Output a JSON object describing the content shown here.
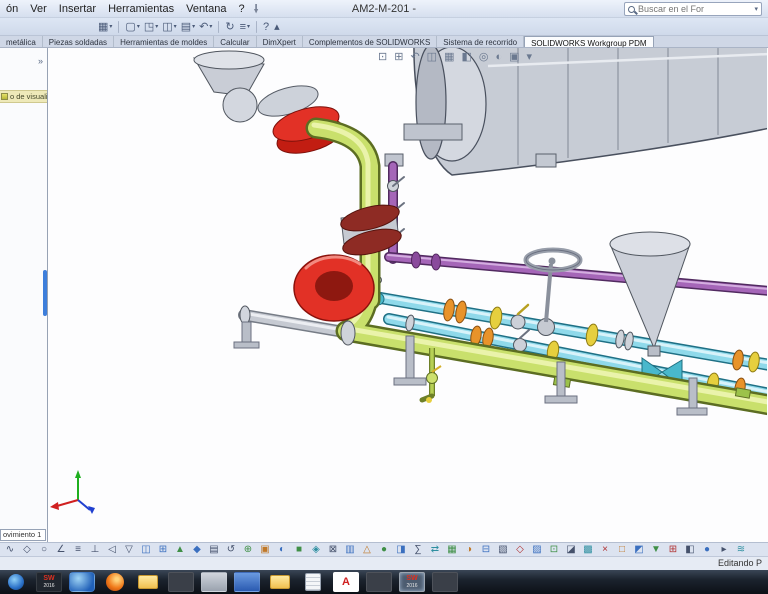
{
  "titlebar": {
    "document": "AM2-M-201 -"
  },
  "menubar": {
    "menus": [
      {
        "name": "menu-edicion",
        "label": "ón"
      },
      {
        "name": "menu-ver",
        "label": "Ver"
      },
      {
        "name": "menu-insertar",
        "label": "Insertar"
      },
      {
        "name": "menu-herramientas",
        "label": "Herramientas"
      },
      {
        "name": "menu-ventana",
        "label": "Ventana"
      },
      {
        "name": "menu-ayuda",
        "label": "?"
      }
    ]
  },
  "search": {
    "placeholder": "Buscar en el For",
    "caret": "▾"
  },
  "quickbar": {
    "icons": [
      {
        "name": "sketch-icon",
        "glyph": "▦",
        "caret": "▾"
      },
      {
        "name": "separator",
        "cls": "sep"
      },
      {
        "name": "new-document-icon",
        "glyph": "▢",
        "caret": "▾"
      },
      {
        "name": "open-icon",
        "glyph": "◳",
        "caret": "▾"
      },
      {
        "name": "save-icon",
        "glyph": "◫",
        "caret": "▾"
      },
      {
        "name": "print-icon",
        "glyph": "▤",
        "caret": "▾"
      },
      {
        "name": "undo-icon",
        "glyph": "↶",
        "caret": "▾"
      },
      {
        "name": "separator",
        "cls": "sep"
      },
      {
        "name": "rebuild-icon",
        "glyph": "↻",
        "caret": ""
      },
      {
        "name": "options-icon",
        "glyph": "≡",
        "caret": "▾"
      },
      {
        "name": "separator",
        "cls": "sep"
      },
      {
        "name": "help-icon",
        "glyph": "?",
        "caret": ""
      },
      {
        "name": "collapse-toolbar-icon",
        "glyph": "▴",
        "caret": ""
      }
    ]
  },
  "tabs": {
    "items": [
      {
        "name": "tab-chapa-metalica",
        "label": "metálica"
      },
      {
        "name": "tab-piezas-soldadas",
        "label": "Piezas soldadas"
      },
      {
        "name": "tab-herramientas-de-moldes",
        "label": "Herramientas de moldes"
      },
      {
        "name": "tab-calcular",
        "label": "Calcular"
      },
      {
        "name": "tab-dimxpert",
        "label": "DimXpert"
      },
      {
        "name": "tab-complementos-solidworks",
        "label": "Complementos de SOLIDWORKS"
      },
      {
        "name": "tab-sistema-de-recorrido",
        "label": "Sistema de recorrido"
      },
      {
        "name": "tab-solidworks-workgroup-pdm",
        "label": "SOLIDWORKS Workgroup PDM",
        "cls": "active"
      }
    ]
  },
  "leftpanel": {
    "expand_icon": "»",
    "display_band": "o de visualización",
    "motion_tab": "ovimiento 1"
  },
  "headsup": {
    "icons": [
      {
        "name": "zoom-fit-icon",
        "glyph": "⊡"
      },
      {
        "name": "zoom-area-icon",
        "glyph": "⊞"
      },
      {
        "name": "previous-view-icon",
        "glyph": "↶"
      },
      {
        "name": "section-view-icon",
        "glyph": "◫"
      },
      {
        "name": "view-orientation-icon",
        "glyph": "▦"
      },
      {
        "name": "display-style-icon",
        "glyph": "◧"
      },
      {
        "name": "hide-show-items-icon",
        "glyph": "◎"
      },
      {
        "name": "edit-appearance-icon",
        "glyph": "◐"
      },
      {
        "name": "apply-scene-icon",
        "glyph": "▣"
      },
      {
        "name": "view-settings-caret-icon",
        "glyph": "▾"
      }
    ]
  },
  "bottombar": {
    "icons": [
      {
        "glyph": "∿",
        "color": "#45516b"
      },
      {
        "glyph": "◇",
        "color": "#45516b"
      },
      {
        "glyph": "○",
        "color": "#45516b"
      },
      {
        "glyph": "∠",
        "color": "#45516b"
      },
      {
        "glyph": "≡",
        "color": "#45516b"
      },
      {
        "glyph": "⊥",
        "color": "#45516b"
      },
      {
        "glyph": "◁",
        "color": "#45516b"
      },
      {
        "glyph": "▽",
        "color": "#45516b"
      },
      {
        "glyph": "◫",
        "color": "#3a6fbf"
      },
      {
        "glyph": "⊞",
        "color": "#3a6fbf"
      },
      {
        "glyph": "▲",
        "color": "#3f8f46"
      },
      {
        "glyph": "◆",
        "color": "#3a6fbf"
      },
      {
        "glyph": "▤",
        "color": "#45516b"
      },
      {
        "glyph": "↺",
        "color": "#45516b"
      },
      {
        "glyph": "⊕",
        "color": "#3f8f46"
      },
      {
        "glyph": "▣",
        "color": "#c07828"
      },
      {
        "glyph": "◐",
        "color": "#3a6fbf"
      },
      {
        "glyph": "■",
        "color": "#3f8f46"
      },
      {
        "glyph": "◈",
        "color": "#2e8fa0"
      },
      {
        "glyph": "⊠",
        "color": "#45516b"
      },
      {
        "glyph": "▥",
        "color": "#3a6fbf"
      },
      {
        "glyph": "△",
        "color": "#c07828"
      },
      {
        "glyph": "●",
        "color": "#3f8f46"
      },
      {
        "glyph": "◨",
        "color": "#3a6fbf"
      },
      {
        "glyph": "∑",
        "color": "#45516b"
      },
      {
        "glyph": "⇄",
        "color": "#2e8fa0"
      },
      {
        "glyph": "▦",
        "color": "#3f8f46"
      },
      {
        "glyph": "◑",
        "color": "#c07828"
      },
      {
        "glyph": "⊟",
        "color": "#3a6fbf"
      },
      {
        "glyph": "▧",
        "color": "#45516b"
      },
      {
        "glyph": "◇",
        "color": "#b03030"
      },
      {
        "glyph": "▨",
        "color": "#3a6fbf"
      },
      {
        "glyph": "⊡",
        "color": "#3f8f46"
      },
      {
        "glyph": "◪",
        "color": "#45516b"
      },
      {
        "glyph": "▩",
        "color": "#2e8fa0"
      },
      {
        "glyph": "×",
        "color": "#b03030"
      },
      {
        "glyph": "□",
        "color": "#c07828"
      },
      {
        "glyph": "◩",
        "color": "#3a6fbf"
      },
      {
        "glyph": "▼",
        "color": "#3f8f46"
      },
      {
        "glyph": "⊞",
        "color": "#b03030"
      },
      {
        "glyph": "◧",
        "color": "#45516b"
      },
      {
        "glyph": "●",
        "color": "#3a6fbf"
      },
      {
        "glyph": "▸",
        "color": "#45516b"
      },
      {
        "glyph": "≋",
        "color": "#2e8fa0"
      }
    ]
  },
  "statusbar": {
    "right": "Editando P"
  },
  "taskbar": {
    "items": [
      {
        "name": "start-button",
        "cls": "tb-start"
      },
      {
        "name": "solidworks-2016-shortcut",
        "cls": "tb-sw",
        "t1": "SW",
        "t2": "2016"
      },
      {
        "name": "globe-app",
        "cls": "tb-globe"
      },
      {
        "name": "firefox",
        "cls": "tb-firefox"
      },
      {
        "name": "folder",
        "cls": "tb-folder"
      },
      {
        "name": "app-dark",
        "cls": "tb-dark"
      },
      {
        "name": "app-window",
        "cls": "tb-window"
      },
      {
        "name": "app-blue",
        "cls": "tb-blue"
      },
      {
        "name": "folder",
        "cls": "tb-folder"
      },
      {
        "name": "document-app",
        "cls": "tb-doc"
      },
      {
        "name": "acrobat",
        "cls": "tb-acrobat",
        "t1": "A"
      },
      {
        "name": "app-dark",
        "cls": "tb-dark"
      },
      {
        "name": "solidworks-2016-active",
        "cls": "tb-sw active",
        "t1": "SW",
        "t2": "2016"
      },
      {
        "name": "app-dark",
        "cls": "tb-dark"
      }
    ]
  },
  "colors": {
    "pipe_green": "#c9e06c",
    "pipe_purple": "#a566b8",
    "pipe_cyan": "#8fd9ea",
    "flange_red": "#e23126",
    "flange_maroon": "#8e2b24",
    "fitting_orange": "#e8932a",
    "fitting_yellow": "#e6cf3e",
    "metal_gray": "#c7ccd5",
    "splitter_blue": "#3d7edb"
  }
}
